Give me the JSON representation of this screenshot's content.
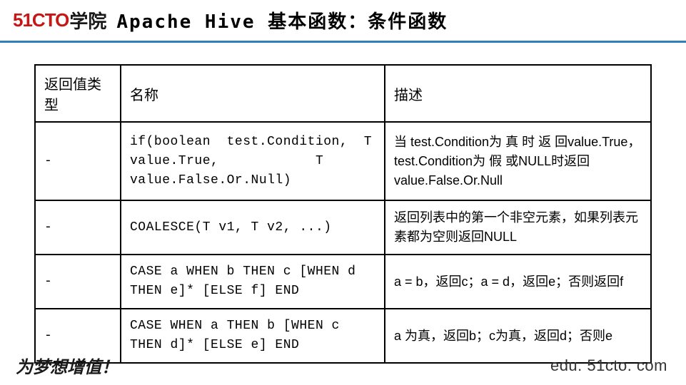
{
  "header": {
    "logo_main": "51CTO",
    "logo_sub": "学院",
    "title_pre": "Apache Hive 基本函数：条件",
    "title_bold": "函数"
  },
  "table": {
    "headers": {
      "c1": "返回值类型",
      "c2": "名称",
      "c3": "描述"
    },
    "rows": [
      {
        "c1": "-",
        "c2": "if(boolean  test.Condition,  T\nvalue.True,            T\nvalue.False.Or.Null)",
        "c3": "当 test.Condition为 真 时 返 回value.True， test.Condition为 假 或NULL时返回value.False.Or.Null"
      },
      {
        "c1": "-",
        "c2": "COALESCE(T v1, T v2, ...)",
        "c3": "返回列表中的第一个非空元素，如果列表元素都为空则返回NULL"
      },
      {
        "c1": "-",
        "c2": "CASE a WHEN b THEN c [WHEN d THEN e]* [ELSE f] END",
        "c3": "a = b，返回c；a = d，返回e；否则返回f"
      },
      {
        "c1": "-",
        "c2": "CASE WHEN a THEN b [WHEN c THEN d]* [ELSE e] END",
        "c3": "a 为真，返回b；c为真，返回d；否则e"
      }
    ]
  },
  "footer": {
    "slogan": "为梦想增值！",
    "url": "edu. 51cto. com"
  }
}
